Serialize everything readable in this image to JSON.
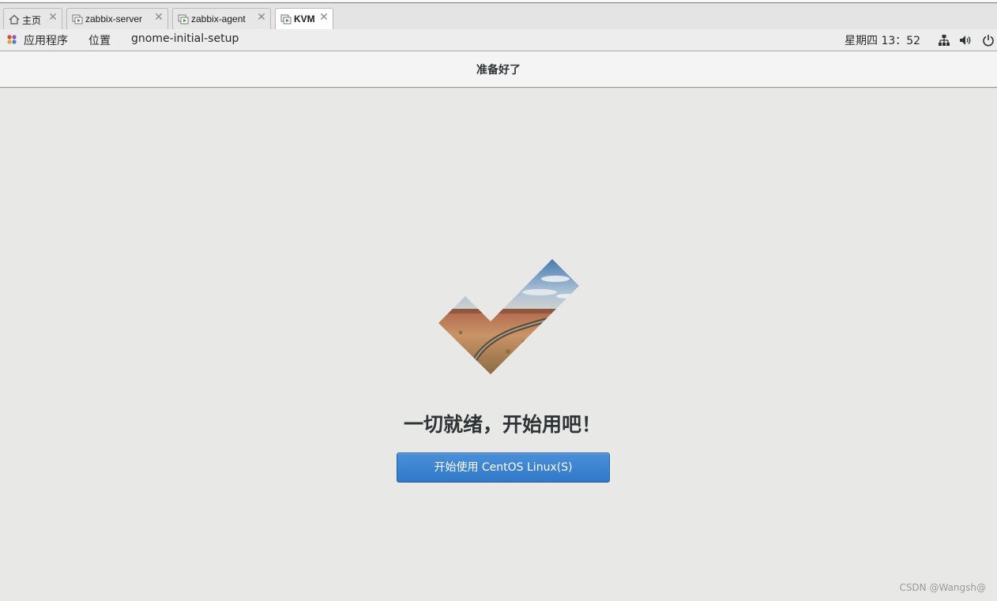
{
  "tabs": [
    {
      "label": "主页",
      "icon": "home-icon",
      "active": false
    },
    {
      "label": "zabbix-server",
      "icon": "vm-icon",
      "active": false
    },
    {
      "label": "zabbix-agent",
      "icon": "vm-icon",
      "active": false
    },
    {
      "label": "KVM",
      "icon": "vm-icon",
      "active": true
    }
  ],
  "tab_close_glyph": "✕",
  "topbar": {
    "applications": "应用程序",
    "places": "位置",
    "app_name": "gnome-initial-setup",
    "clock": "星期四 13：52"
  },
  "header": {
    "title": "准备好了"
  },
  "main": {
    "headline": "一切就绪，开始用吧！",
    "start_button": "开始使用  CentOS Linux(S)"
  },
  "watermark": "CSDN @Wangsh@",
  "colors": {
    "accent": "#3a84d3",
    "background": "#e8e8e7"
  }
}
